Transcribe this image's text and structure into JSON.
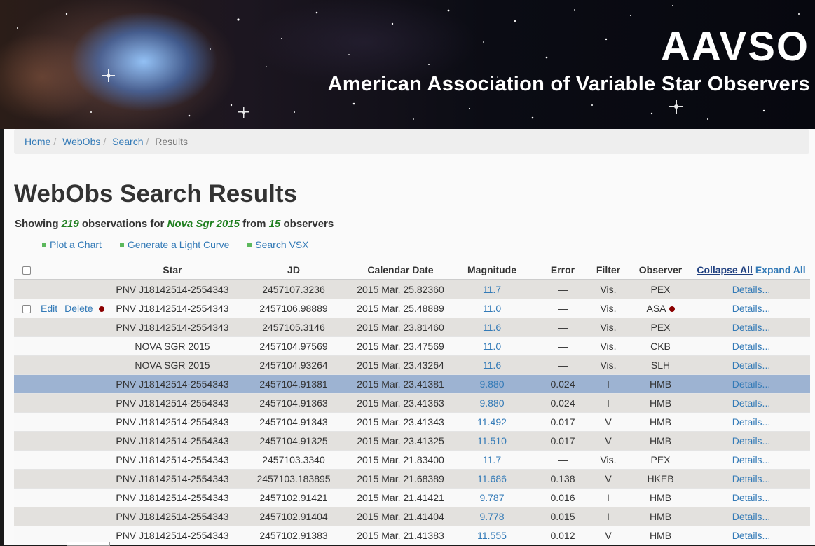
{
  "banner": {
    "title": "AAVSO",
    "subtitle": "American Association of Variable Star Observers"
  },
  "breadcrumb": {
    "items": [
      "Home",
      "WebObs",
      "Search"
    ],
    "current": "Results"
  },
  "page_title": "WebObs Search Results",
  "summary": {
    "prefix": "Showing",
    "count": "219",
    "mid": "observations for",
    "star": "Nova Sgr 2015",
    "from": "from",
    "observers": "15",
    "suffix": "observers"
  },
  "actions": [
    "Plot a Chart",
    "Generate a Light Curve",
    "Search VSX"
  ],
  "table": {
    "headers": {
      "star": "Star",
      "jd": "JD",
      "date": "Calendar Date",
      "magnitude": "Magnitude",
      "error": "Error",
      "filter": "Filter",
      "observer": "Observer",
      "collapse_all": "Collapse All",
      "expand_all": "Expand All"
    },
    "row_action_labels": {
      "edit": "Edit",
      "delete": "Delete"
    },
    "details_label": "Details...",
    "rows": [
      {
        "star": "PNV J18142514-2554343",
        "jd": "2457107.3236",
        "date": "2015 Mar. 25.82360",
        "mag": "11.7",
        "err": "—",
        "filter": "Vis.",
        "observer": "PEX"
      },
      {
        "star": "PNV J18142514-2554343",
        "jd": "2457106.98889",
        "date": "2015 Mar. 25.48889",
        "mag": "11.0",
        "err": "—",
        "filter": "Vis.",
        "observer": "ASA"
      },
      {
        "star": "PNV J18142514-2554343",
        "jd": "2457105.3146",
        "date": "2015 Mar. 23.81460",
        "mag": "11.6",
        "err": "—",
        "filter": "Vis.",
        "observer": "PEX"
      },
      {
        "star": "NOVA SGR 2015",
        "jd": "2457104.97569",
        "date": "2015 Mar. 23.47569",
        "mag": "11.0",
        "err": "—",
        "filter": "Vis.",
        "observer": "CKB"
      },
      {
        "star": "NOVA SGR 2015",
        "jd": "2457104.93264",
        "date": "2015 Mar. 23.43264",
        "mag": "11.6",
        "err": "—",
        "filter": "Vis.",
        "observer": "SLH"
      },
      {
        "star": "PNV J18142514-2554343",
        "jd": "2457104.91381",
        "date": "2015 Mar. 23.41381",
        "mag": "9.880",
        "err": "0.024",
        "filter": "I",
        "observer": "HMB"
      },
      {
        "star": "PNV J18142514-2554343",
        "jd": "2457104.91363",
        "date": "2015 Mar. 23.41363",
        "mag": "9.880",
        "err": "0.024",
        "filter": "I",
        "observer": "HMB"
      },
      {
        "star": "PNV J18142514-2554343",
        "jd": "2457104.91343",
        "date": "2015 Mar. 23.41343",
        "mag": "11.492",
        "err": "0.017",
        "filter": "V",
        "observer": "HMB"
      },
      {
        "star": "PNV J18142514-2554343",
        "jd": "2457104.91325",
        "date": "2015 Mar. 23.41325",
        "mag": "11.510",
        "err": "0.017",
        "filter": "V",
        "observer": "HMB"
      },
      {
        "star": "PNV J18142514-2554343",
        "jd": "2457103.3340",
        "date": "2015 Mar. 21.83400",
        "mag": "11.7",
        "err": "—",
        "filter": "Vis.",
        "observer": "PEX"
      },
      {
        "star": "PNV J18142514-2554343",
        "jd": "2457103.183895",
        "date": "2015 Mar. 21.68389",
        "mag": "11.686",
        "err": "0.138",
        "filter": "V",
        "observer": "HKEB"
      },
      {
        "star": "PNV J18142514-2554343",
        "jd": "2457102.91421",
        "date": "2015 Mar. 21.41421",
        "mag": "9.787",
        "err": "0.016",
        "filter": "I",
        "observer": "HMB"
      },
      {
        "star": "PNV J18142514-2554343",
        "jd": "2457102.91404",
        "date": "2015 Mar. 21.41404",
        "mag": "9.778",
        "err": "0.015",
        "filter": "I",
        "observer": "HMB"
      },
      {
        "star": "PNV J18142514-2554343",
        "jd": "2457102.91383",
        "date": "2015 Mar. 21.41383",
        "mag": "11.555",
        "err": "0.012",
        "filter": "V",
        "observer": "HMB"
      }
    ]
  },
  "colors": {
    "link": "#337ab7",
    "highlight_green": "#1f7f1f",
    "row_selected": "#9db3d2",
    "discrepant_dot": "#8b0000"
  }
}
